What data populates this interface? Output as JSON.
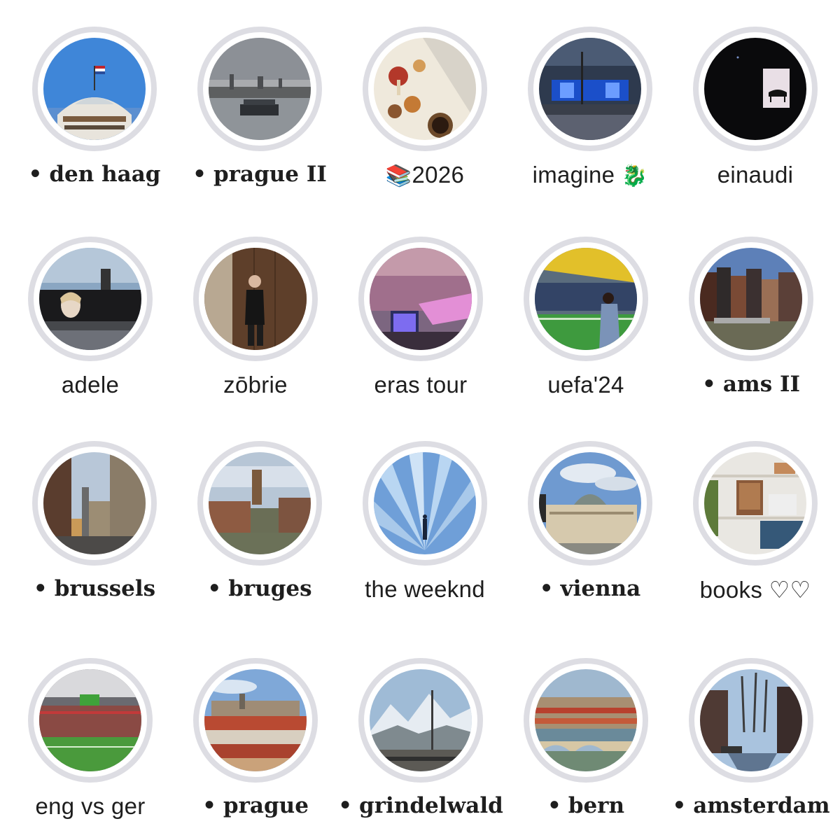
{
  "highlights": [
    {
      "label": "den haag",
      "bullet": "•",
      "style": "serif",
      "icon": "dome-building-with-flag"
    },
    {
      "label": "prague II",
      "bullet": "•",
      "style": "serif",
      "icon": "river-bridge-city"
    },
    {
      "label": "2026",
      "prefix": "📚",
      "style": "sans",
      "icon": "mushroom-book"
    },
    {
      "label": "imagine",
      "suffix": "🐉",
      "style": "sans",
      "icon": "concert-stage-blue"
    },
    {
      "label": "einaudi",
      "style": "sans",
      "icon": "piano-screen-dark"
    },
    {
      "label": "adele",
      "style": "sans",
      "icon": "adele-concert-screen"
    },
    {
      "label": "zōbrie",
      "style": "sans",
      "icon": "mirror-selfie"
    },
    {
      "label": "eras tour",
      "style": "sans",
      "icon": "stadium-pink-stage"
    },
    {
      "label": "uefa'24",
      "style": "sans",
      "icon": "football-stadium-fan"
    },
    {
      "label": "ams II",
      "bullet": "•",
      "style": "serif",
      "icon": "canal-houses"
    },
    {
      "label": "brussels",
      "bullet": "•",
      "style": "serif",
      "icon": "street-buildings"
    },
    {
      "label": "bruges",
      "bullet": "•",
      "style": "serif",
      "icon": "belfry-canal"
    },
    {
      "label": "the weeknd",
      "style": "sans",
      "icon": "light-rays-figure"
    },
    {
      "label": "vienna",
      "bullet": "•",
      "style": "serif",
      "icon": "museum-building"
    },
    {
      "label": "books ♡♡",
      "style": "sans",
      "icon": "bookshelf"
    },
    {
      "label": "eng vs ger",
      "style": "sans",
      "icon": "stadium-pitch"
    },
    {
      "label": "prague",
      "bullet": "•",
      "style": "serif",
      "icon": "red-rooftops-castle"
    },
    {
      "label": "grindelwald",
      "bullet": "•",
      "style": "serif",
      "icon": "snowy-mountains"
    },
    {
      "label": "bern",
      "bullet": "•",
      "style": "serif",
      "icon": "river-bridge-town"
    },
    {
      "label": "amsterdam",
      "bullet": "•",
      "style": "serif",
      "icon": "canal-trees"
    }
  ]
}
